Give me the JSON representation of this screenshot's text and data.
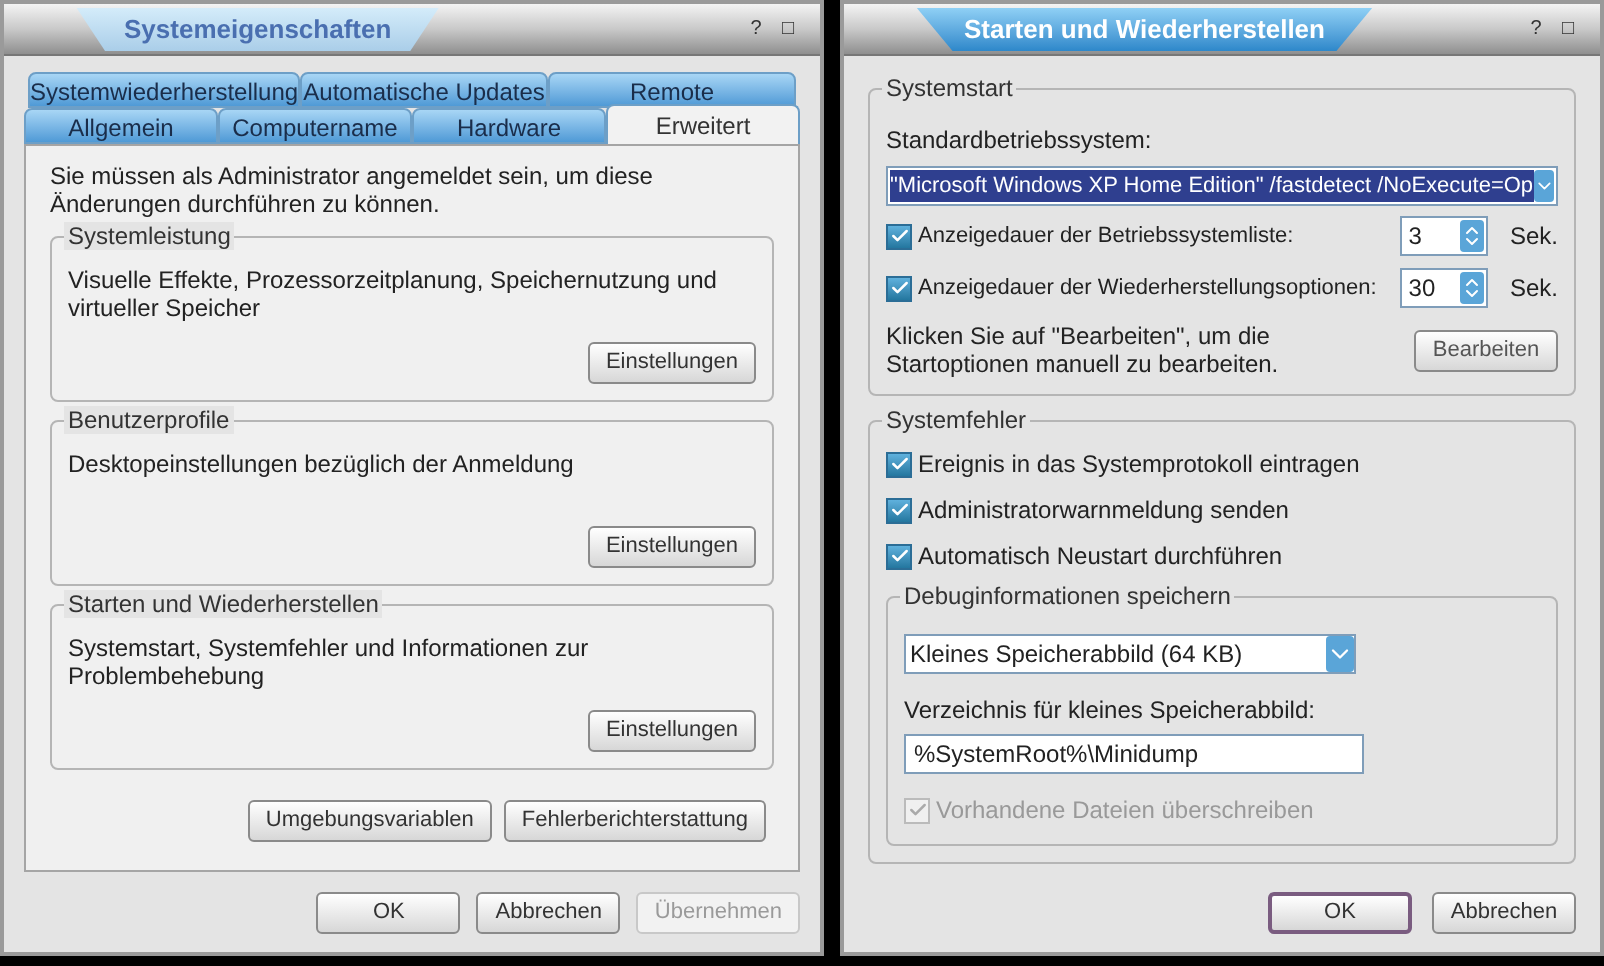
{
  "left_window": {
    "title": "Systemeigenschaften",
    "active": false,
    "title_buttons": [
      "?",
      "□"
    ],
    "tab_rows": [
      [
        {
          "label": "Systemwiederherstellung",
          "selected": false
        },
        {
          "label": "Automatische Updates",
          "selected": false
        },
        {
          "label": "Remote",
          "selected": false
        }
      ],
      [
        {
          "label": "Allgemein",
          "selected": false
        },
        {
          "label": "Computername",
          "selected": false
        },
        {
          "label": "Hardware",
          "selected": false
        },
        {
          "label": "Erweitert",
          "selected": true
        }
      ]
    ],
    "notice": "Sie müssen als Administrator angemeldet sein, um diese Änderungen durchführen zu können.",
    "groups": [
      {
        "title": "Systemleistung",
        "text": "Visuelle Effekte, Prozessorzeitplanung, Speichernutzung und virtueller Speicher",
        "button": "Einstellungen"
      },
      {
        "title": "Benutzerprofile",
        "text": "Desktopeinstellungen bezüglich der Anmeldung",
        "button": "Einstellungen"
      },
      {
        "title": "Starten und Wiederherstellen",
        "text": "Systemstart, Systemfehler und Informationen zur Problembehebung",
        "button": "Einstellungen"
      }
    ],
    "extra_buttons": [
      "Umgebungsvariablen",
      "Fehlerberichterstattung"
    ],
    "footer_buttons": [
      {
        "label": "OK",
        "disabled": false
      },
      {
        "label": "Abbrechen",
        "disabled": false
      },
      {
        "label": "Übernehmen",
        "disabled": true
      }
    ]
  },
  "right_window": {
    "title": "Starten und Wiederherstellen",
    "active": true,
    "title_buttons": [
      "?",
      "□"
    ],
    "systemstart": {
      "title": "Systemstart",
      "default_os_label": "Standardbetriebssystem:",
      "default_os_value": "\"Microsoft Windows XP Home Edition\" /fastdetect /NoExecute=Op",
      "timeouts": [
        {
          "label": "Anzeigedauer der Betriebssystemliste:",
          "checked": true,
          "value": "3",
          "unit": "Sek."
        },
        {
          "label": "Anzeigedauer der Wiederherstellungsoptionen:",
          "checked": true,
          "value": "30",
          "unit": "Sek."
        }
      ],
      "edit_hint": "Klicken Sie auf \"Bearbeiten\", um die Startoptionen manuell zu bearbeiten.",
      "edit_button": "Bearbeiten"
    },
    "systemfehler": {
      "title": "Systemfehler",
      "options": [
        {
          "label": "Ereignis in das Systemprotokoll eintragen",
          "checked": true,
          "disabled": false
        },
        {
          "label": "Administratorwarnmeldung senden",
          "checked": true,
          "disabled": false
        },
        {
          "label": "Automatisch Neustart durchführen",
          "checked": true,
          "disabled": false
        }
      ],
      "debug": {
        "title": "Debuginformationen speichern",
        "dump_type": "Kleines Speicherabbild (64 KB)",
        "dir_label": "Verzeichnis für kleines Speicherabbild:",
        "dir_value": "%SystemRoot%\\Minidump",
        "overwrite": {
          "label": "Vorhandene Dateien überschreiben",
          "checked": true,
          "disabled": true
        }
      }
    },
    "footer_buttons": [
      {
        "label": "OK",
        "default": true
      },
      {
        "label": "Abbrechen",
        "default": false
      }
    ]
  }
}
